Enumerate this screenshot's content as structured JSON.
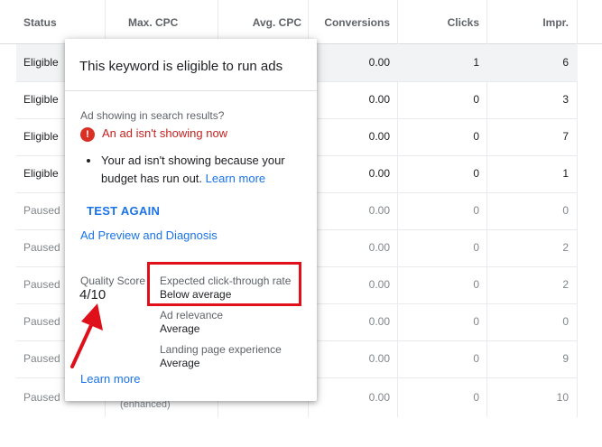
{
  "table": {
    "headers": [
      "Status",
      "Max. CPC",
      "Avg. CPC",
      "Conversions",
      "Clicks",
      "Impr."
    ],
    "rows": [
      {
        "status": "Eligible",
        "conversions": "0.00",
        "clicks": "1",
        "impr": "6"
      },
      {
        "status": "Eligible",
        "conversions": "0.00",
        "clicks": "0",
        "impr": "3"
      },
      {
        "status": "Eligible",
        "conversions": "0.00",
        "clicks": "0",
        "impr": "7"
      },
      {
        "status": "Eligible",
        "conversions": "0.00",
        "clicks": "0",
        "impr": "1"
      },
      {
        "status": "Paused",
        "conversions": "0.00",
        "clicks": "0",
        "impr": "0"
      },
      {
        "status": "Paused",
        "conversions": "0.00",
        "clicks": "0",
        "impr": "2"
      },
      {
        "status": "Paused",
        "conversions": "0.00",
        "clicks": "0",
        "impr": "2"
      },
      {
        "status": "Paused",
        "conversions": "0.00",
        "clicks": "0",
        "impr": "0"
      },
      {
        "status": "Paused",
        "conversions": "0.00",
        "clicks": "0",
        "impr": "9"
      },
      {
        "status": "Paused",
        "conversions": "0.00",
        "clicks": "0",
        "impr": "10"
      }
    ],
    "last_row_extra": "(enhanced)"
  },
  "popup": {
    "title": "This keyword is eligible to run ads",
    "question": "Ad showing in search results?",
    "error": "An ad isn't showing now",
    "bullet_text": "Your ad isn't showing because your budget has run out.",
    "bullet_link": "Learn more",
    "test_again": "TEST AGAIN",
    "ad_preview": "Ad Preview and Diagnosis",
    "quality_score_label": "Quality Score",
    "quality_score_value": "4/10",
    "metrics": [
      {
        "label": "Expected click-through rate",
        "value": "Below average"
      },
      {
        "label": "Ad relevance",
        "value": "Average"
      },
      {
        "label": "Landing page experience",
        "value": "Average"
      }
    ],
    "learn_more": "Learn more"
  },
  "colors": {
    "highlight": "#e0101b",
    "link": "#1a73e8",
    "error": "#c5221f"
  },
  "icons": {
    "error": "error-circle-icon",
    "annotation": "red-arrow-icon"
  }
}
